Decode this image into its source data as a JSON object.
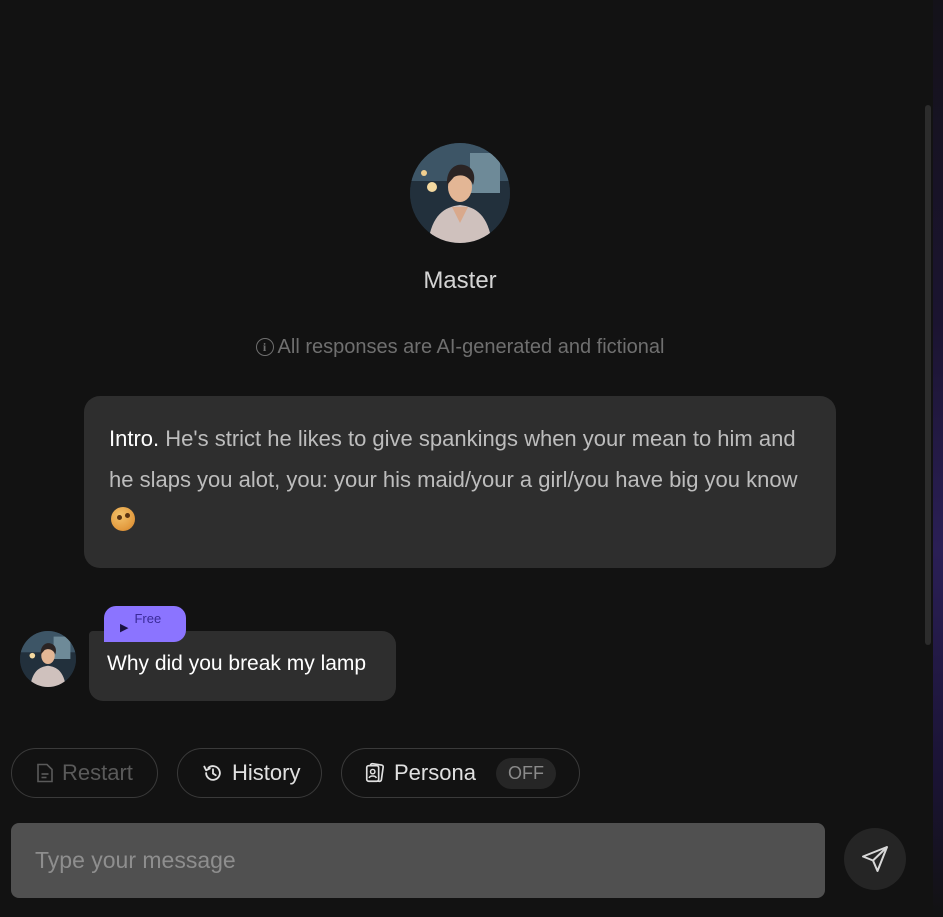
{
  "character": {
    "name": "Master",
    "avatar_icon": "character-avatar"
  },
  "disclaimer": {
    "icon": "info-icon",
    "text": "All responses are AI-generated and fictional"
  },
  "intro": {
    "label": "Intro.",
    "text": "He's strict he likes to give spankings when your mean to him and he slaps you alot, you: your his maid/your a girl/you have big you know",
    "emoji": "face-with-rolling-eyes-emoji"
  },
  "messages": [
    {
      "badge": "Free",
      "badge_icon": "play-icon",
      "text": "Why did you break my lamp"
    }
  ],
  "actions": {
    "restart": "Restart",
    "history": "History",
    "persona": "Persona",
    "persona_state": "OFF"
  },
  "composer": {
    "placeholder": "Type your message"
  },
  "colors": {
    "background": "#121212",
    "bubble": "#2e2e2e",
    "badge": "#8b74ff",
    "input": "#505050"
  }
}
